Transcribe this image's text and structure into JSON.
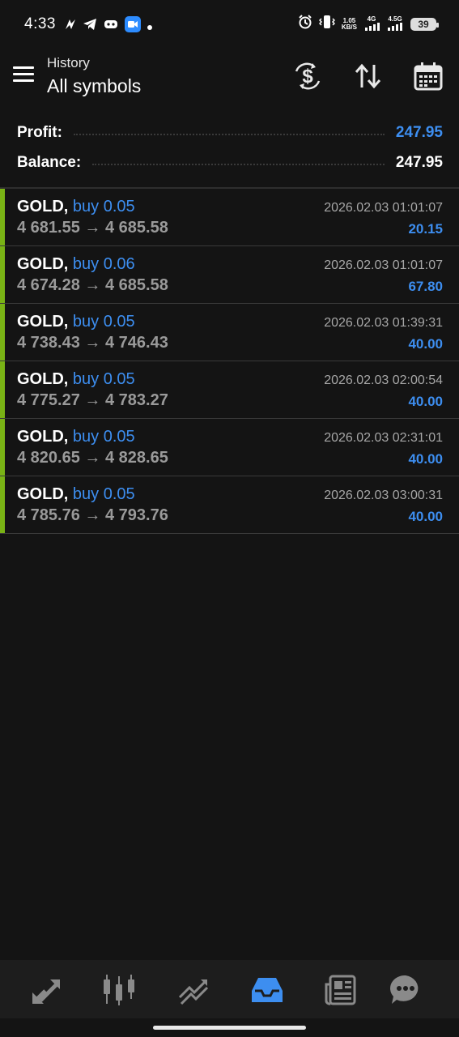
{
  "status_bar": {
    "time": "4:33",
    "net_speed_top": "1.05",
    "net_speed_bottom": "KB/S",
    "signal1_label": "4G",
    "signal2_label": "4.5G",
    "battery": "39"
  },
  "header": {
    "subtitle": "History",
    "title": "All symbols"
  },
  "summary": {
    "profit_label": "Profit:",
    "profit_value": "247.95",
    "balance_label": "Balance:",
    "balance_value": "247.95"
  },
  "deals": [
    {
      "symbol": "GOLD,",
      "type": "buy 0.05",
      "prices": "4 681.55 → 4 685.58",
      "time": "2026.02.03 01:01:07",
      "profit": "20.15"
    },
    {
      "symbol": "GOLD,",
      "type": "buy 0.06",
      "prices": "4 674.28 → 4 685.58",
      "time": "2026.02.03 01:01:07",
      "profit": "67.80"
    },
    {
      "symbol": "GOLD,",
      "type": "buy 0.05",
      "prices": "4 738.43 → 4 746.43",
      "time": "2026.02.03 01:39:31",
      "profit": "40.00"
    },
    {
      "symbol": "GOLD,",
      "type": "buy 0.05",
      "prices": "4 775.27 → 4 783.27",
      "time": "2026.02.03 02:00:54",
      "profit": "40.00"
    },
    {
      "symbol": "GOLD,",
      "type": "buy 0.05",
      "prices": "4 820.65 → 4 828.65",
      "time": "2026.02.03 02:31:01",
      "profit": "40.00"
    },
    {
      "symbol": "GOLD,",
      "type": "buy 0.05",
      "prices": "4 785.76 → 4 793.76",
      "time": "2026.02.03 03:00:31",
      "profit": "40.00"
    }
  ],
  "toolbar_icons": [
    "currency-exchange-icon",
    "sort-icon",
    "calendar-icon"
  ],
  "bottom_nav": [
    "quotes-icon",
    "chart-icon",
    "trade-icon",
    "history-icon",
    "news-icon",
    "messages-icon"
  ],
  "active_nav": "history-icon",
  "colors": {
    "background": "#141414",
    "accent_blue": "#3d8ef0",
    "buy_bar_green": "#79b315",
    "muted_text": "#9a9a9a"
  }
}
